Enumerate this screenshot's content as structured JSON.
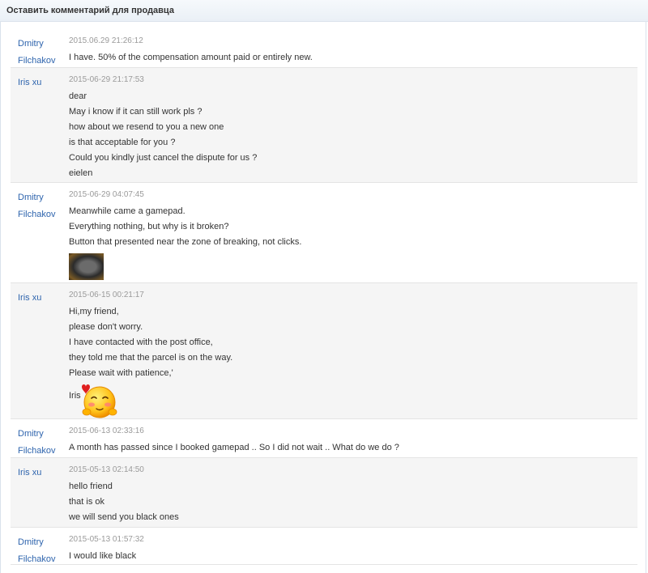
{
  "header": {
    "title": "Оставить комментарий для продавца"
  },
  "messages": [
    {
      "author": [
        "Dmitry",
        "Filchakov"
      ],
      "date": "2015.06.29 21:26:12",
      "lines": [
        "I have. 50% of the compensation amount paid or entirely new."
      ]
    },
    {
      "author": [
        "Iris xu"
      ],
      "date": "2015-06-29 21:17:53",
      "lines": [
        "dear",
        "May i know if it can still work pls ?",
        "how about we resend to you a new one",
        "is that acceptable for you ?",
        "Could you kindly just cancel the dispute for us ?",
        "eielen"
      ]
    },
    {
      "author": [
        "Dmitry",
        "Filchakov"
      ],
      "date": "2015-06-29 04:07:45",
      "lines": [
        "Meanwhile came a gamepad.",
        "Everything nothing, but why is it broken?",
        "Button that presented near the zone of breaking, not clicks."
      ],
      "attachment": "gamepad-photo"
    },
    {
      "author": [
        "Iris xu"
      ],
      "date": "2015-06-15 00:21:17",
      "lines": [
        "Hi,my friend,",
        "please don't worry.",
        "I have contacted with the post office,",
        "they told me that the parcel is on the way.",
        "Please wait with patience,'"
      ],
      "signature": "Iris",
      "sticker": "blushing-face-emoji"
    },
    {
      "author": [
        "Dmitry",
        "Filchakov"
      ],
      "date": "2015-06-13 02:33:16",
      "lines": [
        "A month has passed since I booked gamepad .. So I did not wait .. What do we do ?"
      ]
    },
    {
      "author": [
        "Iris xu"
      ],
      "date": "2015-05-13 02:14:50",
      "lines": [
        "hello friend",
        "that is ok",
        "we will send you black ones"
      ]
    },
    {
      "author": [
        "Dmitry",
        "Filchakov"
      ],
      "date": "2015-05-13 01:57:32",
      "lines": [
        "I would like black"
      ]
    }
  ],
  "colors": {
    "author": "#2e64ad",
    "date": "#9a9a9a",
    "alt_row": "#f5f5f5",
    "header_bg": "#eaf0f6"
  }
}
